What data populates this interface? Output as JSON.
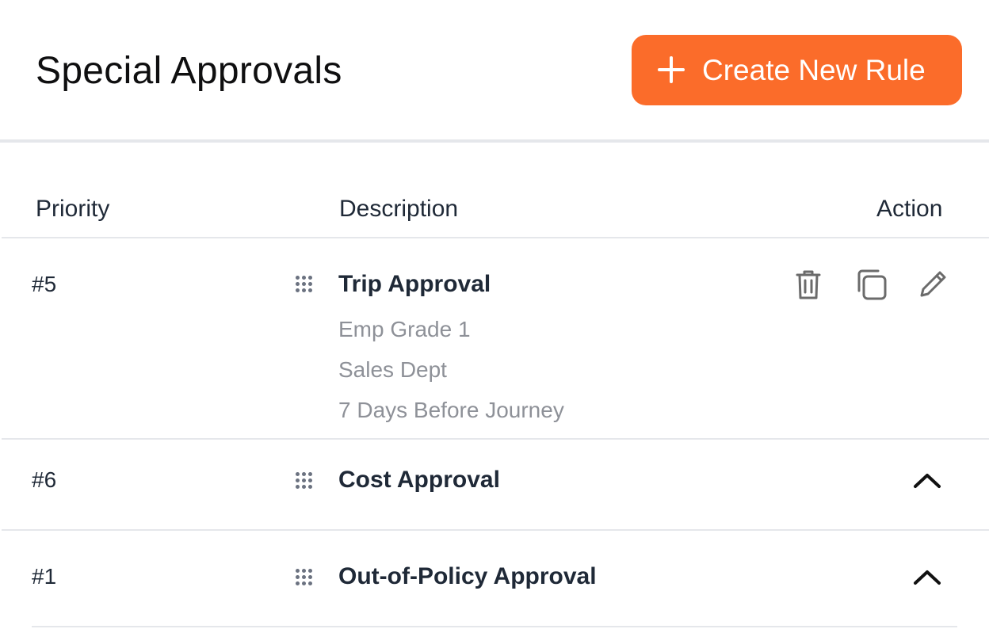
{
  "header": {
    "title": "Special Approvals",
    "create_button_label": "Create New Rule",
    "accent_color": "#fb6c2a"
  },
  "table": {
    "columns": {
      "priority": "Priority",
      "description": "Description",
      "action": "Action"
    },
    "rows": [
      {
        "priority": "#5",
        "title": "Trip Approval",
        "details": [
          "Emp Grade 1",
          "Sales Dept",
          "7 Days Before Journey"
        ],
        "expanded": true,
        "actions": [
          "trash-icon",
          "copy-icon",
          "pencil-icon"
        ]
      },
      {
        "priority": "#6",
        "title": "Cost Approval",
        "expanded": false,
        "actions": [
          "chevron-up-icon"
        ]
      },
      {
        "priority": "#1",
        "title": "Out-of-Policy Approval",
        "expanded": false,
        "actions": [
          "chevron-up-icon"
        ]
      }
    ]
  }
}
